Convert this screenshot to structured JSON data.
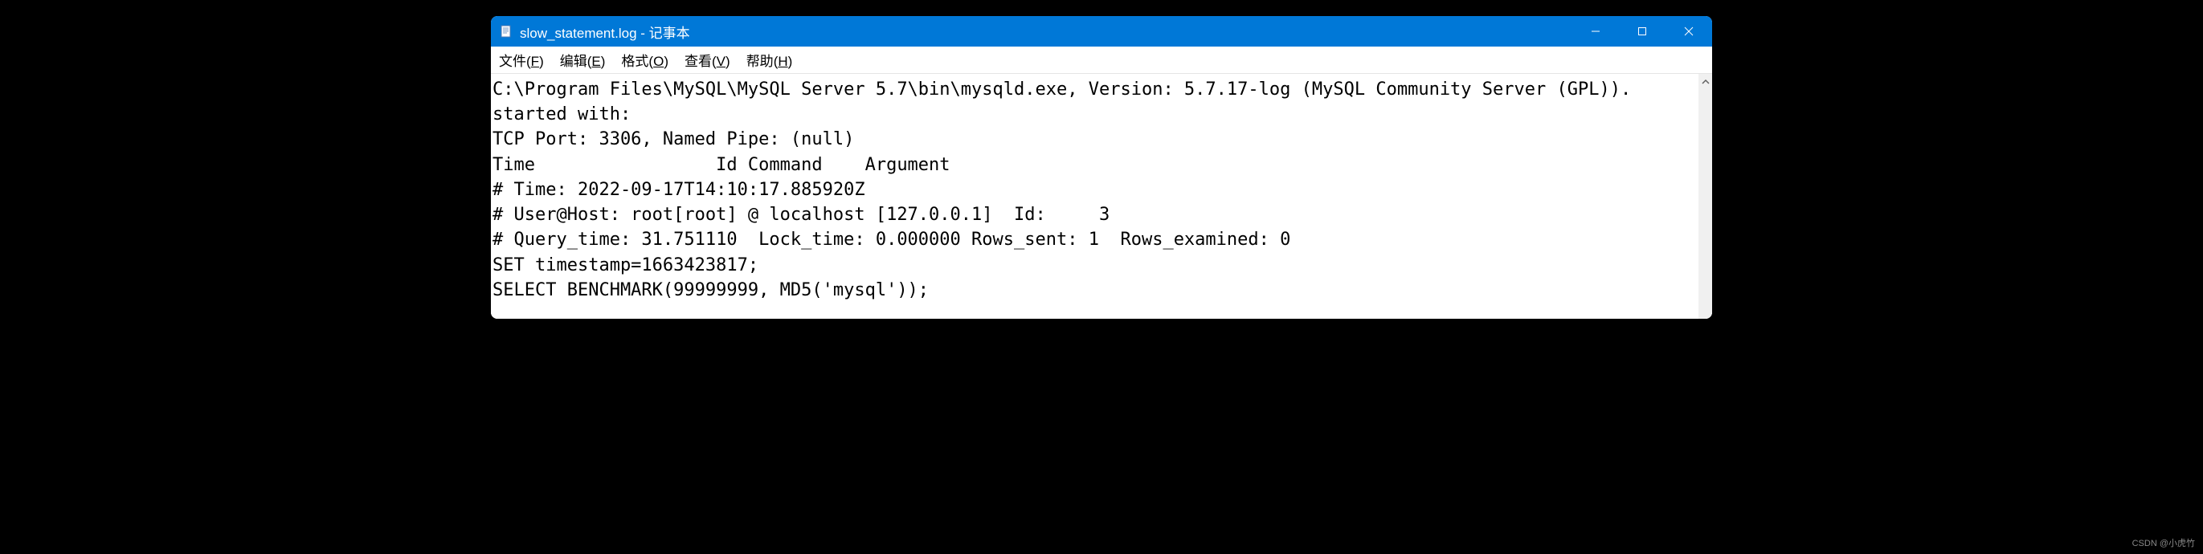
{
  "window": {
    "title": "slow_statement.log - 记事本"
  },
  "menubar": {
    "file": {
      "label": "文件",
      "hotkey": "F"
    },
    "edit": {
      "label": "编辑",
      "hotkey": "E"
    },
    "format": {
      "label": "格式",
      "hotkey": "O"
    },
    "view": {
      "label": "查看",
      "hotkey": "V"
    },
    "help": {
      "label": "帮助",
      "hotkey": "H"
    }
  },
  "content": {
    "line1": "C:\\Program Files\\MySQL\\MySQL Server 5.7\\bin\\mysqld.exe, Version: 5.7.17-log (MySQL Community Server (GPL)). started with:",
    "line2": "TCP Port: 3306, Named Pipe: (null)",
    "line3": "Time                 Id Command    Argument",
    "line4": "# Time: 2022-09-17T14:10:17.885920Z",
    "line5": "# User@Host: root[root] @ localhost [127.0.0.1]  Id:     3",
    "line6": "# Query_time: 31.751110  Lock_time: 0.000000 Rows_sent: 1  Rows_examined: 0",
    "line7": "SET timestamp=1663423817;",
    "line8": "SELECT BENCHMARK(99999999, MD5('mysql'));"
  },
  "watermark": "CSDN @小虎竹"
}
